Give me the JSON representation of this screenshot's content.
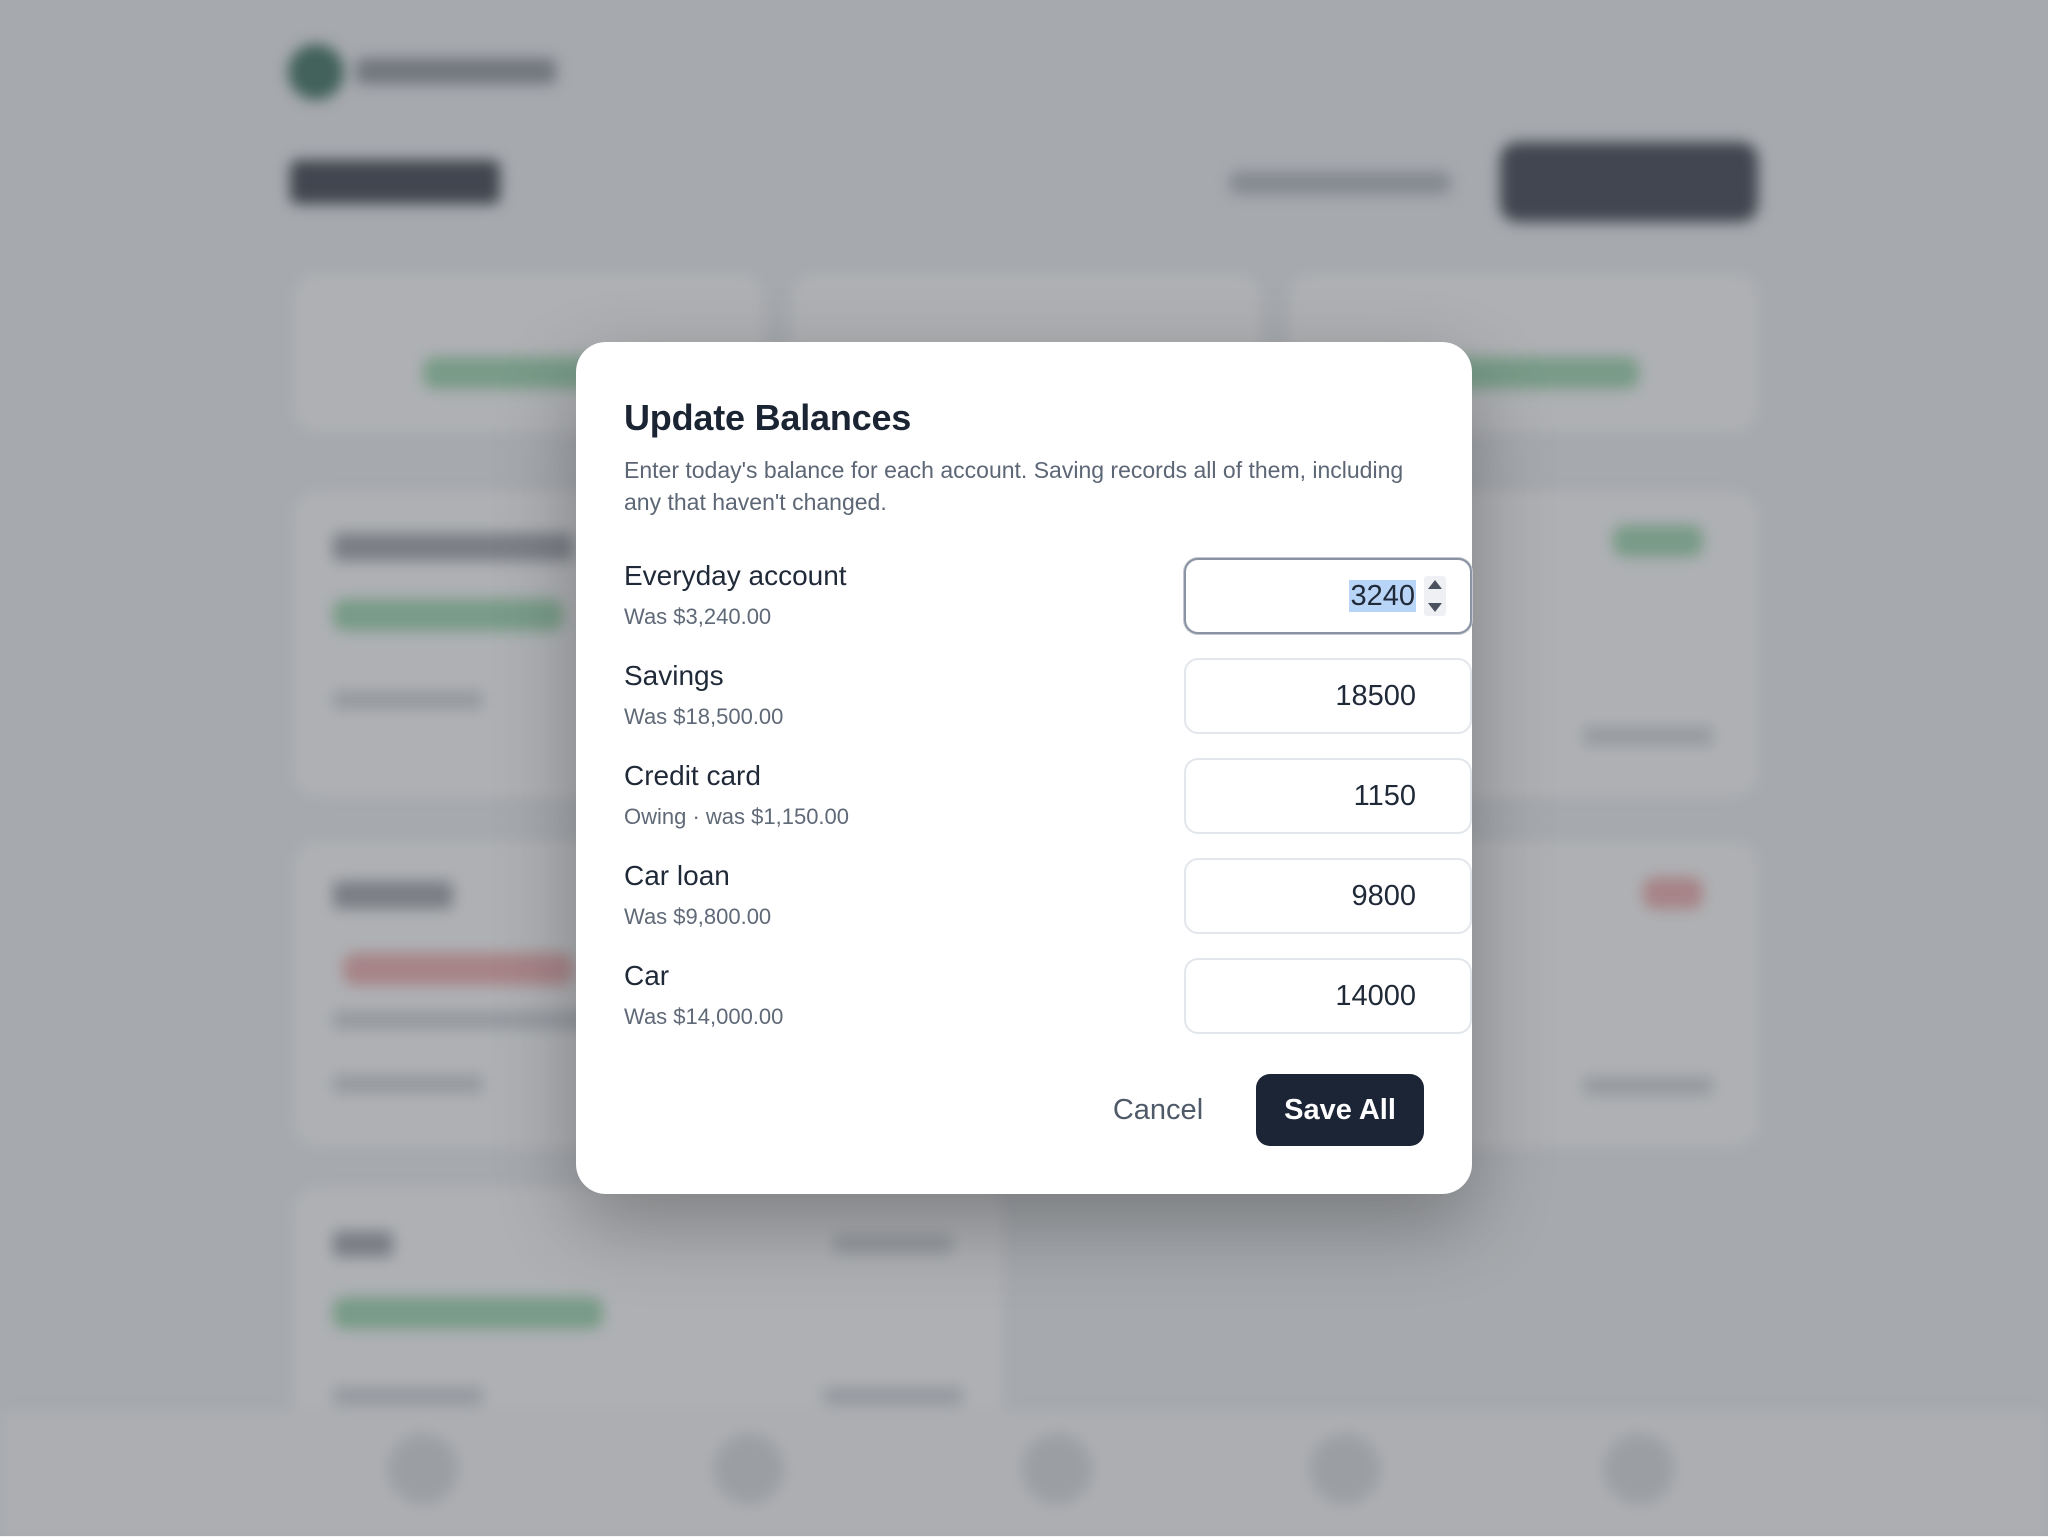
{
  "dialog": {
    "title": "Update Balances",
    "description": "Enter today's balance for each account. Saving records all of them, including any that haven't changed.",
    "accounts": [
      {
        "name": "Everyday account",
        "previous": "Was $3,240.00",
        "value": "3240",
        "focused": true
      },
      {
        "name": "Savings",
        "previous": "Was $18,500.00",
        "value": "18500"
      },
      {
        "name": "Credit card",
        "previous": "Owing · was $1,150.00",
        "value": "1150"
      },
      {
        "name": "Car loan",
        "previous": "Was $9,800.00",
        "value": "9800"
      },
      {
        "name": "Car",
        "previous": "Was $14,000.00",
        "value": "14000"
      }
    ],
    "cancel_label": "Cancel",
    "save_label": "Save All"
  },
  "colors": {
    "primary_button": "#1b2536",
    "overlay": "#64686e",
    "positive": "#8fd3a4",
    "negative": "#f0a3a3"
  }
}
